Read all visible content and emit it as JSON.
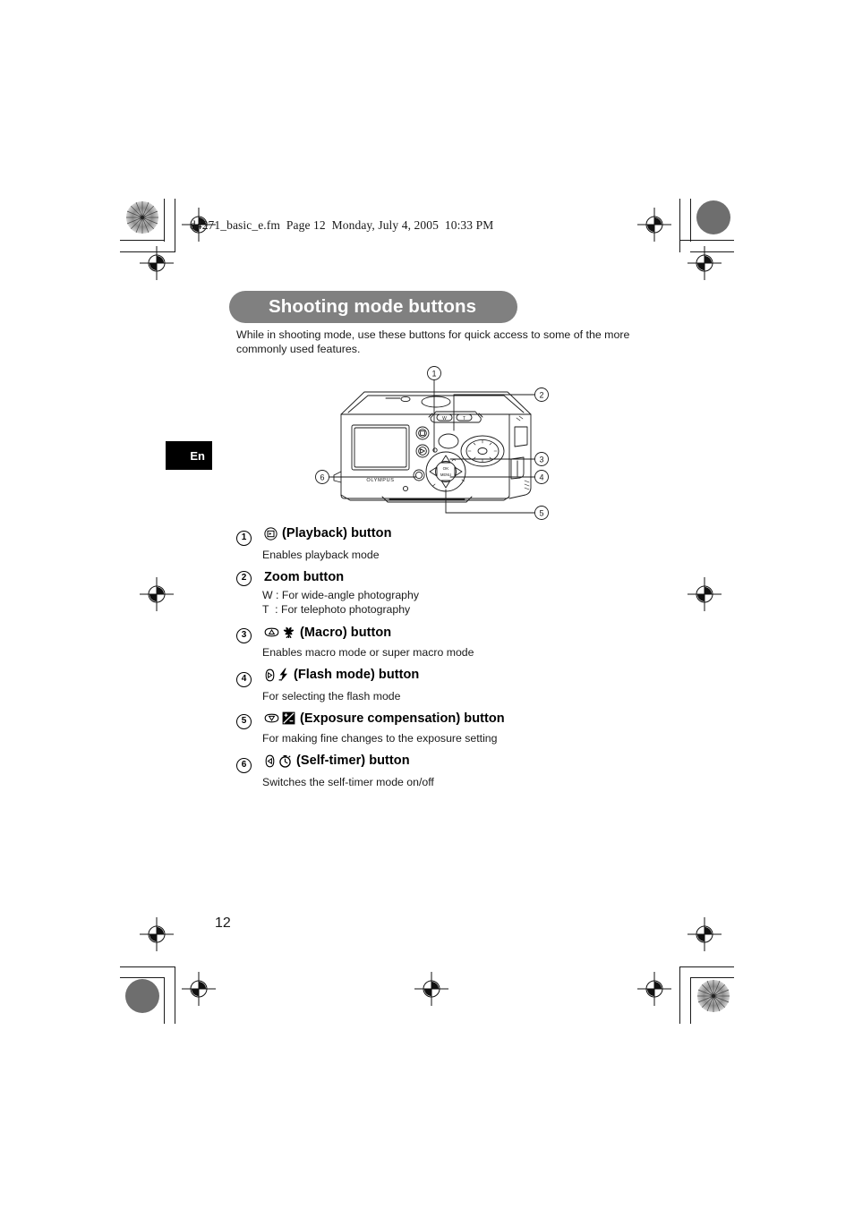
{
  "document": {
    "file_info": "d4271_basic_e.fm  Page 12  Monday, July 4, 2005  10:33 PM",
    "language_tab": "En",
    "page_number": "12"
  },
  "section": {
    "title": "Shooting mode buttons",
    "intro_line1": "While in shooting mode, use these buttons for quick access to some of the more",
    "intro_line2": "commonly used features."
  },
  "figure": {
    "name": "camera-rear-view-diagram",
    "brand_label": "OLYMPUS",
    "pad_label_ok": "OK",
    "pad_label_menu": "MENU",
    "zoom_w": "W",
    "zoom_t": "T",
    "callouts": [
      {
        "id": "1",
        "label": "1"
      },
      {
        "id": "2",
        "label": "2"
      },
      {
        "id": "3",
        "label": "3"
      },
      {
        "id": "4",
        "label": "4"
      },
      {
        "id": "5",
        "label": "5"
      },
      {
        "id": "6",
        "label": "6"
      }
    ]
  },
  "items": [
    {
      "num": "1",
      "icons": [
        "playback-icon"
      ],
      "title": "(Playback) button",
      "desc": [
        "Enables playback mode"
      ]
    },
    {
      "num": "2",
      "icons": [],
      "title": "Zoom button",
      "desc": [
        "W : For wide-angle photography",
        "T  : For telephoto photography"
      ]
    },
    {
      "num": "3",
      "icons": [
        "arrow-up-key-icon",
        "macro-tulip-icon"
      ],
      "title": "(Macro) button",
      "desc": [
        "Enables macro mode or super macro mode"
      ]
    },
    {
      "num": "4",
      "icons": [
        "arrow-right-key-icon",
        "flash-bolt-icon"
      ],
      "title": "(Flash mode) button",
      "desc": [
        "For selecting the flash mode"
      ]
    },
    {
      "num": "5",
      "icons": [
        "arrow-down-key-icon",
        "exposure-compensation-icon"
      ],
      "title": "(Exposure compensation) button",
      "desc": [
        "For making fine changes to the exposure setting"
      ]
    },
    {
      "num": "6",
      "icons": [
        "arrow-left-key-icon",
        "self-timer-icon"
      ],
      "title": "(Self-timer) button",
      "desc": [
        "Switches the self-timer mode on/off"
      ]
    }
  ],
  "colors": {
    "banner_gray": "#808080",
    "text_black": "#1a1a1a",
    "tab_black": "#000000",
    "mark_gray": "#6e6e6e"
  }
}
